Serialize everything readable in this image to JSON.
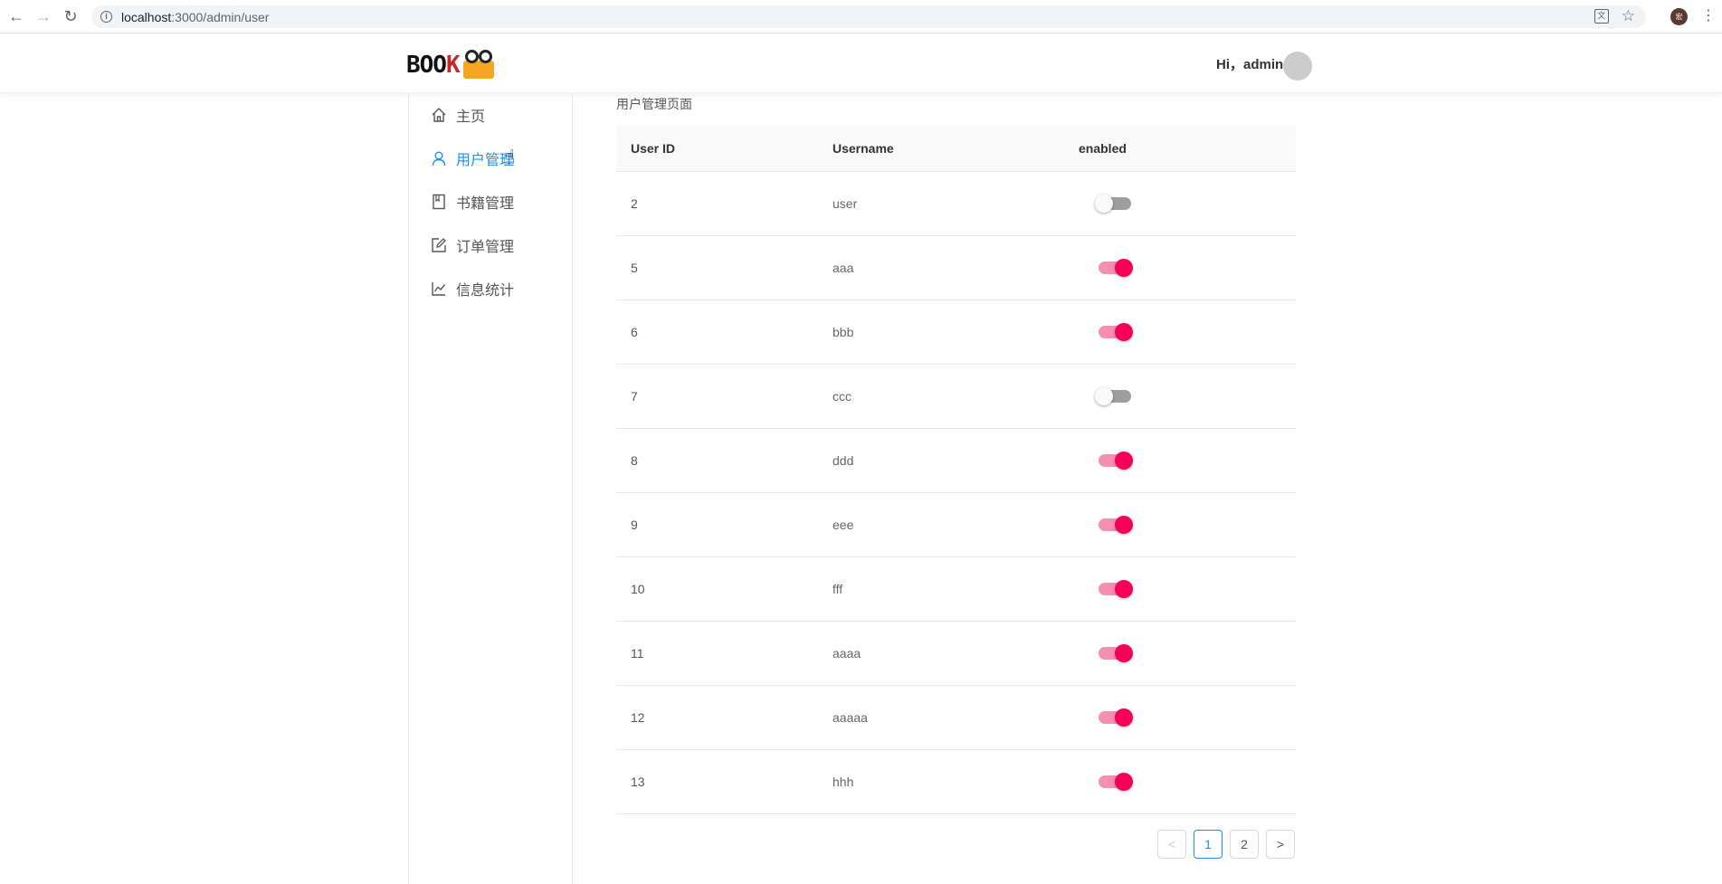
{
  "browser": {
    "url_host": "localhost",
    "url_path": ":3000/admin/user",
    "profile_initial": "宏"
  },
  "header": {
    "logo_text_main": "BOO",
    "logo_text_accent": "K",
    "greeting": "Hi，admin"
  },
  "sidebar": {
    "items": [
      {
        "label": "主页",
        "icon": "home-icon"
      },
      {
        "label": "用户管理",
        "icon": "user-icon",
        "active": true
      },
      {
        "label": "书籍管理",
        "icon": "book-icon"
      },
      {
        "label": "订单管理",
        "icon": "edit-icon"
      },
      {
        "label": "信息统计",
        "icon": "line-chart-icon"
      }
    ]
  },
  "main": {
    "title": "用户管理页面",
    "columns": [
      "User ID",
      "Username",
      "enabled"
    ],
    "rows": [
      {
        "id": "2",
        "username": "user",
        "enabled": false
      },
      {
        "id": "5",
        "username": "aaa",
        "enabled": true
      },
      {
        "id": "6",
        "username": "bbb",
        "enabled": true
      },
      {
        "id": "7",
        "username": "ccc",
        "enabled": false
      },
      {
        "id": "8",
        "username": "ddd",
        "enabled": true
      },
      {
        "id": "9",
        "username": "eee",
        "enabled": true
      },
      {
        "id": "10",
        "username": "fff",
        "enabled": true
      },
      {
        "id": "11",
        "username": "aaaa",
        "enabled": true
      },
      {
        "id": "12",
        "username": "aaaaa",
        "enabled": true
      },
      {
        "id": "13",
        "username": "hhh",
        "enabled": true
      }
    ],
    "pagination": {
      "prev": "<",
      "pages": [
        "1",
        "2"
      ],
      "current": "1",
      "next": ">"
    }
  },
  "colors": {
    "accent": "#1890ff",
    "toggle_on": "#f50057",
    "toggle_track_on": "#f48fb1",
    "toggle_track_off": "#9e9e9e"
  }
}
